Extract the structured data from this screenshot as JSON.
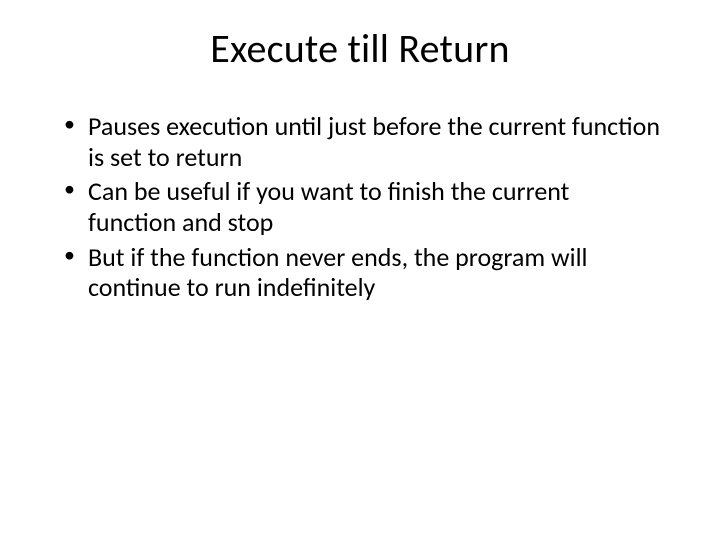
{
  "slide": {
    "title": "Execute till Return",
    "bullets": [
      "Pauses execution until just before the current function is set to return",
      "Can be useful if you want to finish the current function and stop",
      "But if the function never ends, the program will continue to run indefinitely"
    ]
  }
}
